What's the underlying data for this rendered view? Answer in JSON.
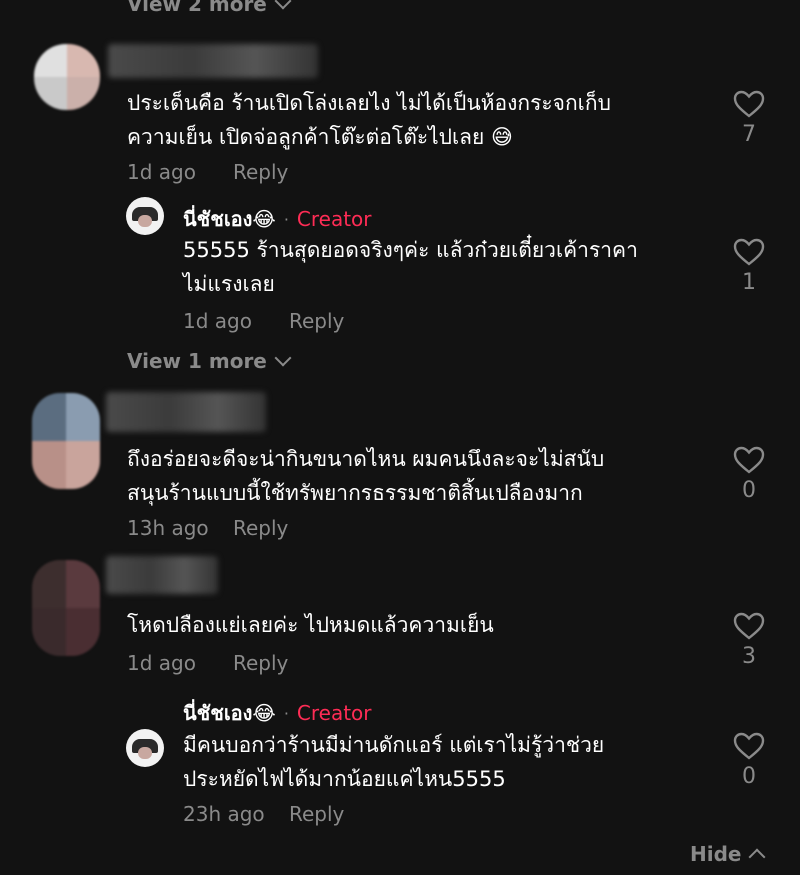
{
  "top_view_more": {
    "label": "View 2 more"
  },
  "comments": [
    {
      "text_lines": [
        "ประเด็นคือ ร้านเปิดโล่งเลยไง ไม่ได้เป็นห้องกระจกเก็บ",
        "ความเย็น เปิดจ่อลูกค้าโต๊ะต่อโต๊ะไปเลย 😅"
      ],
      "time": "1d ago",
      "reply_label": "Reply",
      "likes": "7",
      "replies": [
        {
          "author": "นี่ชัชเอง😂",
          "separator": "·",
          "badge": "Creator",
          "text_lines": [
            "55555 ร้านสุดยอดจริงๆค่ะ แล้วก๋วยเตี๋ยวเค้าราคา",
            "ไม่แรงเลย"
          ],
          "time": "1d ago",
          "reply_label": "Reply",
          "likes": "1"
        }
      ],
      "view_more": "View 1 more"
    },
    {
      "text_lines": [
        "ถึงอร่อยจะดีจะน่ากินขนาดไหน ผมคนนึงละจะไม่สนับ",
        "สนุนร้านแบบนี้ใช้ทรัพยากรธรรมชาติสิ้นเปลืองมาก"
      ],
      "time": "13h ago",
      "reply_label": "Reply",
      "likes": "0"
    },
    {
      "text_lines": [
        "โหดปลืองแย่เลยค่ะ ไปหมดแล้วความเย็น"
      ],
      "time": "1d ago",
      "reply_label": "Reply",
      "likes": "3",
      "replies": [
        {
          "author": "นี่ชัชเอง😂",
          "separator": "·",
          "badge": "Creator",
          "text_lines": [
            "มีคนบอกว่าร้านมีม่านดักแอร์ แต่เราไม่รู้ว่าช่วย",
            "ประหยัดไฟได้มากน้อยแค่ไหน5555"
          ],
          "time": "23h ago",
          "reply_label": "Reply",
          "likes": "0"
        }
      ]
    }
  ],
  "hide_label": "Hide",
  "colors": {
    "background": "#121212",
    "muted": "#8a8a8a",
    "creator": "#fe2c55"
  }
}
